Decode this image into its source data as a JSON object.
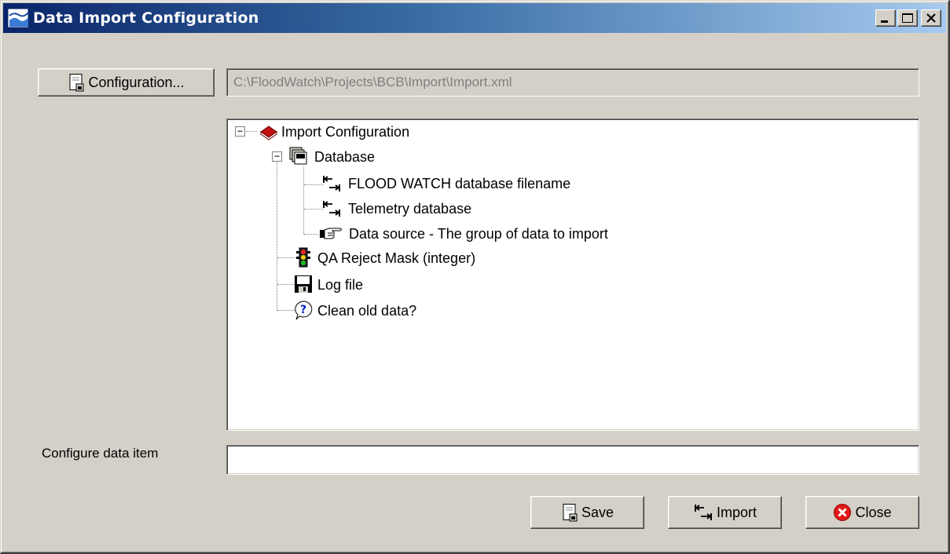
{
  "window": {
    "title": "Data Import Configuration",
    "buttons": {
      "minimize": "minimize-icon",
      "maximize": "maximize-icon",
      "close": "close-icon"
    }
  },
  "config_button": {
    "label": "Configuration..."
  },
  "config_path": {
    "value": "C:\\FloodWatch\\Projects\\BCB\\Import\\Import.xml"
  },
  "tree": {
    "root": {
      "label": "Import Configuration",
      "icon": "book-icon",
      "expanded": true
    },
    "database": {
      "label": "Database",
      "icon": "database-icon",
      "expanded": true
    },
    "items": [
      {
        "label": "FLOOD WATCH database filename",
        "icon": "import-arrow-icon"
      },
      {
        "label": "Telemetry database",
        "icon": "import-arrow-icon"
      },
      {
        "label": "Data source - The group of data to import",
        "icon": "pointing-hand-icon"
      },
      {
        "label": "QA Reject Mask (integer)",
        "icon": "traffic-light-icon"
      },
      {
        "label": "Log file",
        "icon": "floppy-disk-icon"
      },
      {
        "label": "Clean old data?",
        "icon": "question-icon"
      }
    ]
  },
  "configure_item": {
    "label": "Configure data item",
    "value": ""
  },
  "actions": {
    "save": "Save",
    "import": "Import",
    "close": "Close"
  }
}
